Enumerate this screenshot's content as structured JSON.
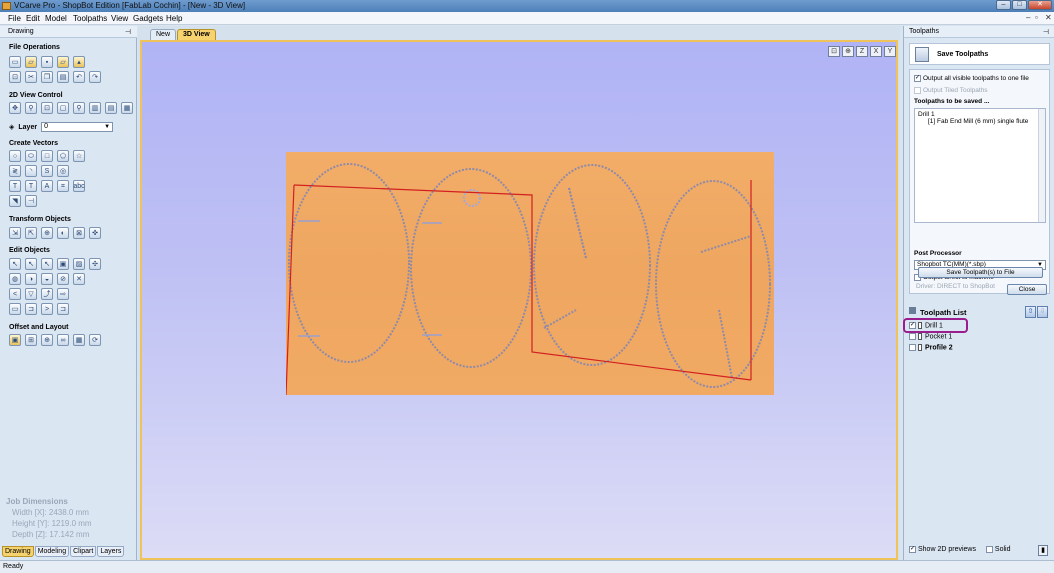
{
  "window": {
    "title": "VCarve Pro - ShopBot Edition [FabLab Cochin] - [New - 3D View]",
    "controls": [
      "–",
      "□",
      "✕"
    ]
  },
  "menu": {
    "items": [
      "File",
      "Edit",
      "Model",
      "Toolpaths",
      "View",
      "Gadgets",
      "Help"
    ],
    "mdi_controls": [
      "–",
      "▫",
      "✕"
    ]
  },
  "left_panel": {
    "title": "Drawing",
    "pin": "⊣",
    "sections": {
      "file_operations": "File Operations",
      "view_control": "2D View Control",
      "create_vectors": "Create Vectors",
      "transform_objects": "Transform Objects",
      "edit_objects": "Edit Objects",
      "offset_layout": "Offset and Layout"
    },
    "layer": {
      "label": "Layer",
      "value": "0"
    },
    "job_dimensions": {
      "title": "Job Dimensions",
      "width": "Width  [X]: 2438.0 mm",
      "height": "Height [Y]: 1219.0 mm",
      "depth": "Depth  [Z]: 17.142 mm"
    },
    "tabs": [
      "Drawing",
      "Modeling",
      "Clipart",
      "Layers"
    ],
    "active_tab": "Drawing"
  },
  "document": {
    "tabs": [
      "New",
      "3D View"
    ],
    "active_tab": "3D View",
    "view_tools": [
      "⊡",
      "⊕",
      "Z",
      "X",
      "Y"
    ]
  },
  "right_panel": {
    "title": "Toolpaths",
    "pin": "⊣",
    "save_header": "Save Toolpaths",
    "options": {
      "output_all": "Output all visible toolpaths to one file",
      "output_tiled": "Output Tiled Toolpaths"
    },
    "to_be_saved_label": "Toolpaths to be saved ...",
    "to_be_saved": [
      "Drill 1",
      "[1] Fab End Mill (6 mm) single flute"
    ],
    "post_processor_label": "Post Processor",
    "post_processor_value": "Shopbot TC(MM)(*.sbp)",
    "output_direct": "Output direct to machine",
    "driver_text": "Driver: DIRECT to ShopBot",
    "save_button": "Save Toolpath(s) to File",
    "close_button": "Close",
    "list_title": "Toolpath List",
    "list_items": [
      {
        "name": "Drill 1",
        "checked": true
      },
      {
        "name": "Pocket 1",
        "checked": false
      },
      {
        "name": "Profile 2",
        "checked": false
      }
    ],
    "show_2d": "Show 2D previews",
    "solid": "Solid"
  },
  "status": {
    "text": "Ready"
  },
  "colors": {
    "accent_tab": "#f6d36e",
    "board": "#f0a860",
    "outline_red": "#d22020",
    "highlight": "#9a1d8e"
  }
}
